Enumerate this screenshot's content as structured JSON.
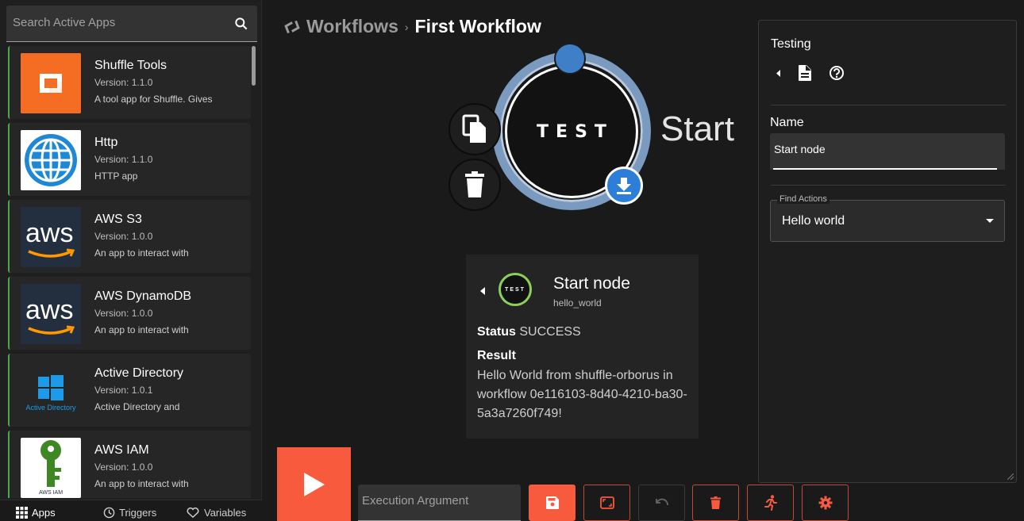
{
  "search": {
    "placeholder": "Search Active Apps"
  },
  "apps": [
    {
      "name": "Shuffle Tools",
      "version": "Version: 1.1.0",
      "description": "A tool app for Shuffle. Gives"
    },
    {
      "name": "Http",
      "version": "Version: 1.1.0",
      "description": "HTTP app"
    },
    {
      "name": "AWS S3",
      "version": "Version: 1.0.0",
      "description": "An app to interact with",
      "logo_text": "aws"
    },
    {
      "name": "AWS DynamoDB",
      "version": "Version: 1.0.0",
      "description": "An app to interact with",
      "logo_text": "aws"
    },
    {
      "name": "Active Directory",
      "version": "Version: 1.0.1",
      "description": "Active Directory and",
      "logo_text": "Active Directory"
    },
    {
      "name": "AWS IAM",
      "version": "Version: 1.0.0",
      "description": "An app to interact with",
      "logo_text": "AWS IAM"
    }
  ],
  "bottom_tabs": [
    {
      "label": "Apps",
      "icon": "grid-icon"
    },
    {
      "label": "Triggers",
      "icon": "clock-icon"
    },
    {
      "label": "Variables",
      "icon": "heart-icon"
    }
  ],
  "header": {
    "workflows": "Workflows",
    "separator": "›",
    "current": "First Workflow"
  },
  "node": {
    "logo_text": "TEST",
    "label": "Start",
    "ring_color": "#7a9ac0",
    "download_color": "#2d7ed8",
    "top_dot_color": "#3f7fc8"
  },
  "result": {
    "avatar_text": "TEST",
    "name": "Start node",
    "action": "hello_world",
    "status_label": "Status",
    "status_value": "SUCCESS",
    "result_label": "Result",
    "result_text": "Hello World from shuffle-orborus in workflow 0e116103-8d40-4210-ba30-5a3a7260f749!"
  },
  "right_panel": {
    "title": "Testing",
    "name_label": "Name",
    "name_value": "Start node",
    "find_actions_legend": "Find Actions",
    "find_actions_value": "Hello world"
  },
  "toolbar": {
    "execution_argument_placeholder": "Execution Argument",
    "accent_color": "#f85a3e"
  }
}
